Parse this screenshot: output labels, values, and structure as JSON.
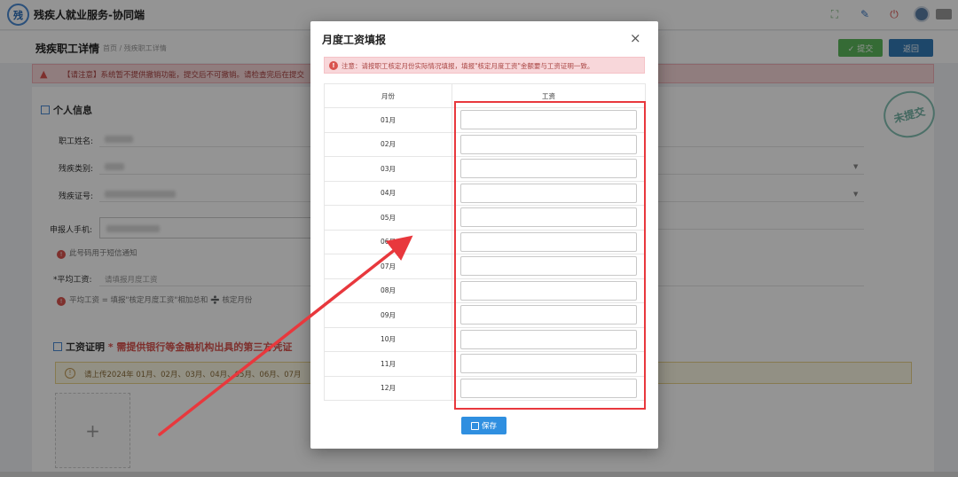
{
  "app": {
    "title": "残疾人就业服务-协同端",
    "logo_text": "残"
  },
  "header_icons": [
    "expand-icon",
    "brush-icon",
    "power-icon",
    "avatar",
    "user-menu"
  ],
  "page": {
    "title": "残疾职工详情",
    "breadcrumb": "首页 / 残疾职工详情",
    "submit_label": "✓ 提交",
    "back_label": "返回"
  },
  "warning": {
    "text": "【请注意】系统暂不提供撤销功能，提交后不可撤销。请检查完后在提交"
  },
  "personal": {
    "section_title": "个人信息",
    "name_label": "职工姓名:",
    "disability_type_label": "残疾类别:",
    "disability_id_label": "残疾证号:",
    "phone_label": "申报人手机:",
    "phone_hint": "此号码用于短信通知",
    "avg_salary_label": "*平均工资:",
    "avg_salary_placeholder": "请填报月度工资",
    "avg_hint": "平均工资 = 填报\"核定月度工资\"相加总和 ➗ 核定月份"
  },
  "stamp_text": "未提交",
  "proof": {
    "title": "工资证明",
    "required_note": "* 需提供银行等金融机构出具的第三方凭证",
    "upload_hint": "请上传2024年 01月、02月、03月、04月、05月、06月、07月",
    "upload_plus": "+"
  },
  "modal": {
    "title": "月度工资填报",
    "close": "×",
    "notice": "注意：请按职工核定月份实际情况填报，填报\"核定月度工资\"金额要与工资证明一致。",
    "col_month": "月份",
    "col_salary": "工资",
    "rows": [
      {
        "month": "01月",
        "salary": ""
      },
      {
        "month": "02月",
        "salary": ""
      },
      {
        "month": "03月",
        "salary": ""
      },
      {
        "month": "04月",
        "salary": ""
      },
      {
        "month": "05月",
        "salary": ""
      },
      {
        "month": "06月",
        "salary": ""
      },
      {
        "month": "07月",
        "salary": ""
      },
      {
        "month": "08月",
        "salary": ""
      },
      {
        "month": "09月",
        "salary": ""
      },
      {
        "month": "10月",
        "salary": ""
      },
      {
        "month": "11月",
        "salary": ""
      },
      {
        "month": "12月",
        "salary": ""
      }
    ],
    "save_label": "保存"
  },
  "colors": {
    "accent": "#2f8fe0",
    "highlight": "#e8383d",
    "danger": "#d9534f",
    "success": "#5cb85c"
  }
}
